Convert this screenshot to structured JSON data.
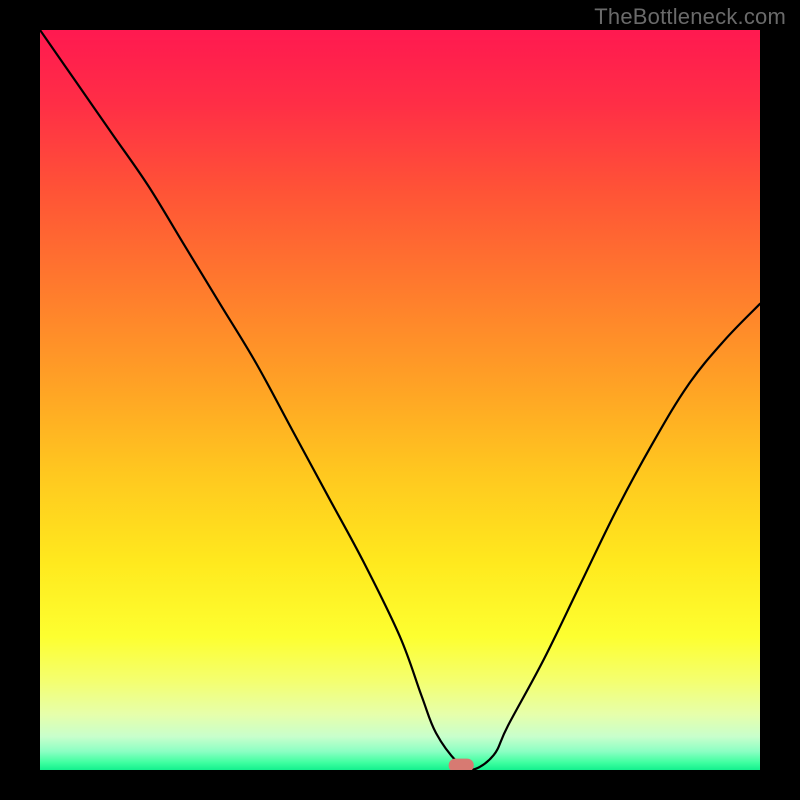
{
  "watermark": "TheBottleneck.com",
  "chart_data": {
    "type": "line",
    "title": "",
    "xlabel": "",
    "ylabel": "",
    "xlim": [
      0,
      100
    ],
    "ylim": [
      0,
      100
    ],
    "grid": false,
    "legend": false,
    "series": [
      {
        "name": "bottleneck-curve",
        "x": [
          0,
          5,
          10,
          15,
          20,
          25,
          30,
          35,
          40,
          45,
          50,
          53,
          55,
          58,
          60,
          63,
          65,
          70,
          75,
          80,
          85,
          90,
          95,
          100
        ],
        "y": [
          100,
          93,
          86,
          79,
          71,
          63,
          55,
          46,
          37,
          28,
          18,
          10,
          5,
          1,
          0,
          2,
          6,
          15,
          25,
          35,
          44,
          52,
          58,
          63
        ]
      }
    ],
    "marker": {
      "name": "optimal-point",
      "x": 58.5,
      "y": 0,
      "width_frac": 0.035,
      "height_frac": 0.018,
      "color": "#d77a72"
    },
    "gradient_stops": [
      {
        "offset": 0.0,
        "color": "#ff1950"
      },
      {
        "offset": 0.1,
        "color": "#ff2e46"
      },
      {
        "offset": 0.22,
        "color": "#ff5436"
      },
      {
        "offset": 0.35,
        "color": "#ff7b2d"
      },
      {
        "offset": 0.48,
        "color": "#ffa225"
      },
      {
        "offset": 0.6,
        "color": "#ffc81f"
      },
      {
        "offset": 0.72,
        "color": "#ffe91e"
      },
      {
        "offset": 0.82,
        "color": "#fdff30"
      },
      {
        "offset": 0.88,
        "color": "#f4ff70"
      },
      {
        "offset": 0.925,
        "color": "#e6ffab"
      },
      {
        "offset": 0.955,
        "color": "#c8ffcc"
      },
      {
        "offset": 0.975,
        "color": "#8bffc3"
      },
      {
        "offset": 0.99,
        "color": "#3effa0"
      },
      {
        "offset": 1.0,
        "color": "#14f08e"
      }
    ],
    "curve_color": "#000000",
    "curve_width": 2.2
  }
}
